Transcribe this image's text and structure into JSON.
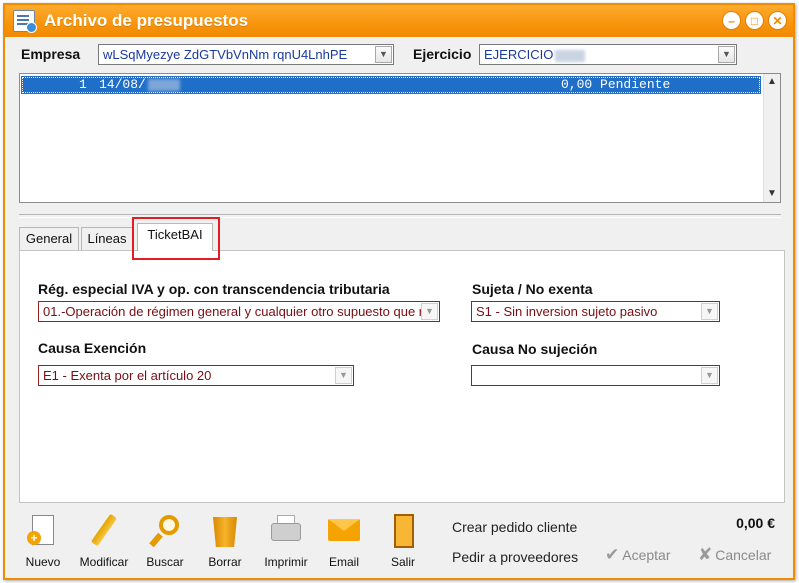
{
  "window": {
    "title": "Archivo de presupuestos",
    "accent_color": "#f08c00",
    "controls": [
      "minimize-icon",
      "maximize-icon",
      "close-icon"
    ]
  },
  "header": {
    "empresa_label": "Empresa",
    "empresa_value": "wLSqMyezye ZdGTVbVnNm rqnU4LnhPE",
    "ejercicio_label": "Ejercicio",
    "ejercicio_value": "EJERCICIO"
  },
  "list": {
    "rows": [
      {
        "number": "1",
        "date": "14/08/",
        "amount": "0,00",
        "status": "Pendiente"
      }
    ],
    "selected_color": "#1f6fc9"
  },
  "tabs": [
    {
      "label": "General",
      "active": false
    },
    {
      "label": "Líneas",
      "active": false
    },
    {
      "label": "TicketBAI",
      "active": true
    }
  ],
  "ticketbai": {
    "regimen_label": "Rég. especial IVA y op. con transcendencia tributaria",
    "regimen_value": "01.-Operación de régimen general y cualquier otro supuesto que n",
    "sujeta_label": "Sujeta / No exenta",
    "sujeta_value": "S1 - Sin inversion sujeto pasivo",
    "causa_exencion_label": "Causa Exención",
    "causa_exencion_value": "E1 - Exenta por el artículo 20",
    "causa_no_sujecion_label": "Causa No sujeción",
    "causa_no_sujecion_value": ""
  },
  "toolbar": {
    "buttons": [
      {
        "label": "Nuevo",
        "icon": "new-document-icon"
      },
      {
        "label": "Modificar",
        "icon": "pencil-icon"
      },
      {
        "label": "Buscar",
        "icon": "magnifier-icon"
      },
      {
        "label": "Borrar",
        "icon": "trash-bin-icon"
      },
      {
        "label": "Imprimir",
        "icon": "printer-icon"
      },
      {
        "label": "Email",
        "icon": "envelope-icon"
      },
      {
        "label": "Salir",
        "icon": "exit-door-icon"
      }
    ],
    "crear_pedido": "Crear pedido cliente",
    "pedir_proveedores": "Pedir a proveedores",
    "total": "0,00 €",
    "aceptar": "Aceptar",
    "cancelar": "Cancelar"
  }
}
